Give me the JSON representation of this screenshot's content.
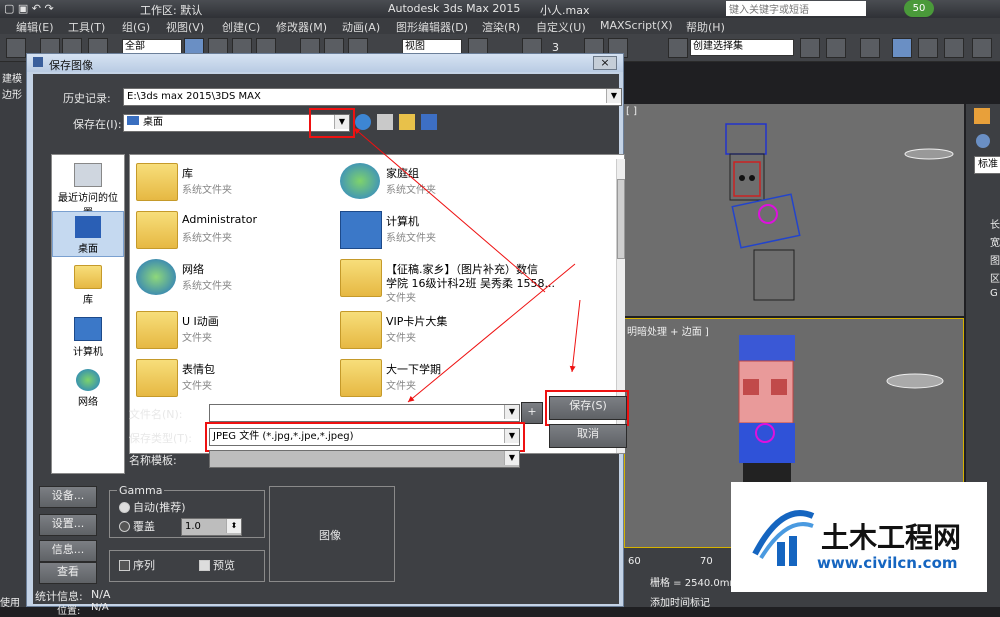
{
  "app": {
    "title": "Autodesk 3ds Max  2015",
    "filename": "小人.max",
    "workspace_label": "工作区: 默认",
    "search_placeholder": "键入关键字或短语",
    "badge": "50"
  },
  "menu": [
    "编辑(E)",
    "工具(T)",
    "组(G)",
    "视图(V)",
    "创建(C)",
    "修改器(M)",
    "动画(A)",
    "图形编辑器(D)",
    "渲染(R)",
    "自定义(U)",
    "MAXScript(X)",
    "帮助(H)"
  ],
  "toolbar": {
    "filter_value": "全部",
    "view_value": "视图",
    "selset_value": "创建选择集",
    "snap_value": "3"
  },
  "left_labels": [
    "建模",
    "边形"
  ],
  "viewports": {
    "top_label": "[ ]",
    "bottom_label": "明暗处理 + 边面 ]"
  },
  "cmd_panel": {
    "value": "标准",
    "items": [
      "长",
      "宽",
      "图",
      "区",
      "G"
    ]
  },
  "status": {
    "ticks": [
      "60",
      "70"
    ],
    "grid": "栅格 = 2540.0mm",
    "addtime": "添加时间标记",
    "use": "使用"
  },
  "dialog": {
    "title": "保存图像",
    "close": "×",
    "history_label": "历史记录:",
    "history_value": "E:\\3ds max 2015\\3DS MAX",
    "savein_label": "保存在(I):",
    "savein_value": "桌面",
    "places": [
      "最近访问的位置",
      "桌面",
      "库",
      "计算机",
      "网络"
    ],
    "files": [
      {
        "name": "库",
        "sub": "系统文件夹"
      },
      {
        "name": "家庭组",
        "sub": "系统文件夹"
      },
      {
        "name": "Administrator",
        "sub": "系统文件夹"
      },
      {
        "name": "计算机",
        "sub": "系统文件夹"
      },
      {
        "name": "网络",
        "sub": "系统文件夹"
      },
      {
        "name": "【征稿.家乡】（图片补充）数信",
        "name2": "学院 16级计科2班 吴秀柔 1558...",
        "sub": "文件夹"
      },
      {
        "name": "U I动画",
        "sub": "文件夹"
      },
      {
        "name": "VIP卡片大集",
        "sub": "文件夹"
      },
      {
        "name": "表情包",
        "sub": "文件夹"
      },
      {
        "name": "大一下学期",
        "sub": "文件夹"
      }
    ],
    "filename_label": "文件名(N):",
    "filename_value": "",
    "plus": "+",
    "type_label": "保存类型(T):",
    "type_value": "JPEG 文件 (*.jpg,*.jpe,*.jpeg)",
    "template_label": "名称模板:",
    "save_btn": "保存(S)",
    "cancel_btn": "取消",
    "side_buttons": [
      "设备...",
      "设置...",
      "信息...",
      "查看"
    ],
    "gamma_title": "Gamma",
    "gamma_auto": "自动(推荐)",
    "gamma_override": "覆盖",
    "gamma_value": "1.0",
    "sequence_label": "序列",
    "preview_label": "预览",
    "image_label": "图像",
    "stats_label": "统计信息:",
    "stats_value": "N/A",
    "location_label": "位置:",
    "location_value": "N/A"
  },
  "watermark": {
    "cn": "土木工程网",
    "url": "www.civilcn.com"
  },
  "colors": {
    "red_annotation": "#ee1111",
    "dialog_body": "#3e4044",
    "watermark_blue": "#1565c0"
  }
}
